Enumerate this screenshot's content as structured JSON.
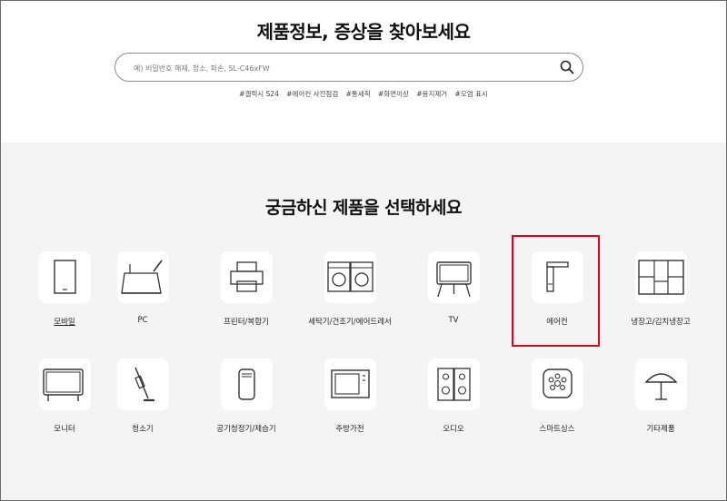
{
  "header": {
    "title": "제품정보, 증상을 찾아보세요",
    "search_placeholder": "예) 비밀번호 해제, 청소, 파손, SL-C46xFW",
    "search_icon": "magnifier-icon",
    "tags": [
      "#갤럭시 S24",
      "#에어컨 사전점검",
      "#통세척",
      "#화면이상",
      "#용지제거",
      "#오염 표시"
    ]
  },
  "section": {
    "title": "궁금하신 제품을 선택하세요",
    "categories": [
      {
        "label": "모바일",
        "icon": "mobile-icon"
      },
      {
        "label": "PC",
        "icon": "laptop-icon"
      },
      {
        "label": "프린터/복합기",
        "icon": "printer-icon"
      },
      {
        "label": "세탁기/건조기/에어드레서",
        "icon": "washer-icon"
      },
      {
        "label": "TV",
        "icon": "tv-icon"
      },
      {
        "label": "에어컨",
        "icon": "air-conditioner-icon"
      },
      {
        "label": "냉장고/김치냉장고",
        "icon": "refrigerator-icon"
      },
      {
        "label": "모니터",
        "icon": "monitor-icon"
      },
      {
        "label": "청소기",
        "icon": "vacuum-icon"
      },
      {
        "label": "공기청정기/제습기",
        "icon": "air-purifier-icon"
      },
      {
        "label": "주방가전",
        "icon": "microwave-icon"
      },
      {
        "label": "오디오",
        "icon": "speaker-icon"
      },
      {
        "label": "스마트싱스",
        "icon": "smartthings-icon"
      },
      {
        "label": "기타제품",
        "icon": "lamp-icon"
      }
    ],
    "highlight_color": "#e0001b"
  }
}
